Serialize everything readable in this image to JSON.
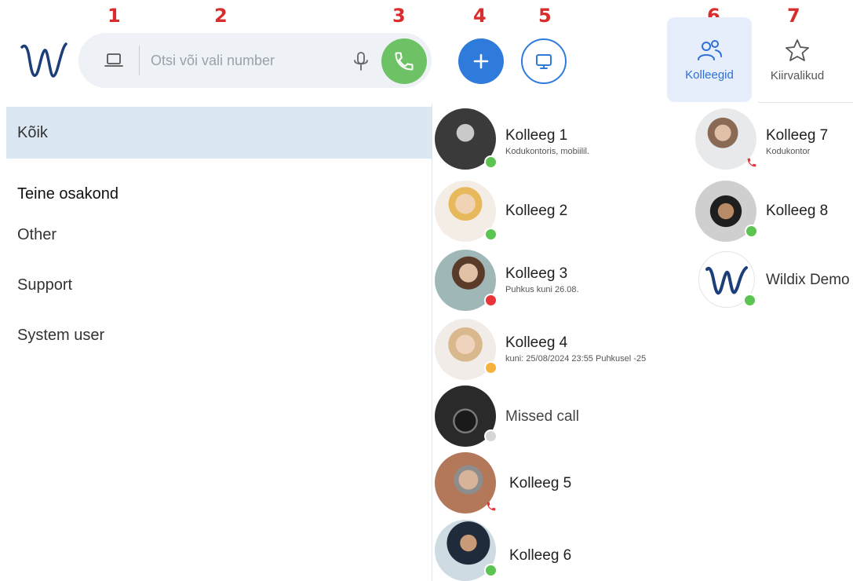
{
  "annotations": [
    "1",
    "2",
    "3",
    "4",
    "5",
    "6",
    "7"
  ],
  "search": {
    "placeholder": "Otsi või vali number"
  },
  "tabs": {
    "colleagues": "Kolleegid",
    "speed_dials": "Kiirvalikud"
  },
  "sidebar": {
    "all": "Kõik",
    "department": "Teine osakond",
    "items": [
      "Other",
      "Support",
      "System user"
    ]
  },
  "contacts": [
    {
      "name": "Kolleeg 1",
      "status_text": "Kodukontoris, mobiilil.",
      "status": "online",
      "status_color": "#5cc450"
    },
    {
      "name": "Kolleeg 2",
      "status_text": "",
      "status": "online",
      "status_color": "#5cc450"
    },
    {
      "name": "Kolleeg 3",
      "status_text": "Puhkus kuni 26.08.",
      "status": "busy",
      "status_color": "#e8343a"
    },
    {
      "name": "Kolleeg 4",
      "status_text": "kuni: 25/08/2024 23:55 Puhkusel -25",
      "status": "away",
      "status_color": "#f6b23c"
    },
    {
      "name": "Missed call",
      "status_text": "",
      "status": "offline",
      "status_color": "#d6d6d6"
    },
    {
      "name": "Kolleeg 5",
      "status_text": "",
      "status": "on-call",
      "status_color": "#e8343a"
    },
    {
      "name": "Kolleeg 6",
      "status_text": "",
      "status": "online",
      "status_color": "#5cc450"
    },
    {
      "name": "Kolleeg 7",
      "status_text": "Kodukontor",
      "status": "on-call",
      "status_color": "#e8343a"
    },
    {
      "name": "Kolleeg 8",
      "status_text": "",
      "status": "online",
      "status_color": "#5cc450"
    },
    {
      "name": "Wildix Demo",
      "status_text": "",
      "status": "online",
      "status_color": "#5cc450"
    }
  ],
  "colors": {
    "accent": "#2f7bdc",
    "call_green": "#6cc264",
    "sidebar_active": "#dbe8f4",
    "annotation_red": "#d92c2c"
  }
}
